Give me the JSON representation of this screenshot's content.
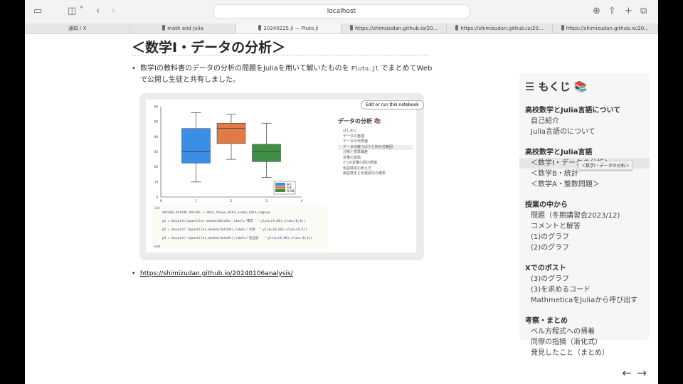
{
  "browser": {
    "url": "localhost",
    "tabs": [
      {
        "label": "通知 / X"
      },
      {
        "label": "math and Julia"
      },
      {
        "label": "20240225.jl — Pluto.jl"
      },
      {
        "label": "https://shimizudan.github.io/20..."
      },
      {
        "label": "https://shimizudan.github.io/20..."
      },
      {
        "label": "https://shimizudan.github.io/20..."
      }
    ]
  },
  "main": {
    "heading": "＜数学I・データの分析＞",
    "para1": "数学Iの教科書のデータの分析の問題をJuliaを用いて解いたものを",
    "para1_code": "Pluto.jl",
    "para1_tail": "でまとめてWebで公開し生徒と共有しました。",
    "link": "https://shimizudan.github.io/20240106analysis/"
  },
  "embed": {
    "edit_button": "Edit or run this notebook",
    "toc_title": "データの分析 📚",
    "toc_items": [
      "はじめに",
      "データの整理",
      "データの代表値",
      "データの散らばりと四分位範囲",
      "分散と標準偏差",
      "変量の変換",
      "2つの変量の間の関係",
      "仮説検定の考え方",
      "仮説検定と反復試行の確率"
    ],
    "code": [
      "let",
      "    data9a,data9b,data9c = data_tokyo,data_osaka,data_nagoya",
      "",
      "    p1 = boxplot(quantiles_monka(data9a),label=\"東京  \",ylim=(0,60),xlim=(0,4))",
      "",
      "    p2 = boxplot!(quantiles_monka(data9b),label=\"大阪  \",ylim=(0,60),xlim=(0,4))",
      "",
      "    p3 = boxplot!(quantiles_monka(data9c),label=\"名古屋   \",ylim=(0,60),xlim=(0,4))",
      "",
      "end"
    ]
  },
  "chart_data": {
    "type": "box",
    "xlim": [
      0,
      4
    ],
    "ylim": [
      0,
      60
    ],
    "xticks": [
      "0",
      "1",
      "2",
      "3",
      "4"
    ],
    "yticks": [
      "0",
      "10",
      "20",
      "30",
      "40",
      "50",
      "60"
    ],
    "series": [
      {
        "name": "東京",
        "x": 1,
        "min": 10,
        "q1": 22.5,
        "median": 30,
        "q3": 45.5,
        "max": 56,
        "color": "#3a8ee6"
      },
      {
        "name": "大阪",
        "x": 2,
        "min": 25,
        "q1": 35.5,
        "median": 45.5,
        "q3": 49,
        "max": 55,
        "color": "#e07b45"
      },
      {
        "name": "名古屋",
        "x": 3,
        "min": 13,
        "q1": 23.5,
        "median": 30,
        "q3": 35,
        "max": 49,
        "color": "#3f8f45"
      }
    ],
    "legend": "bottom-right"
  },
  "toc": {
    "title": "もくじ 📚",
    "sections": [
      {
        "heading": "高校数学とJulia言語について",
        "items": [
          "自己紹介",
          "Julia言語のについて"
        ]
      },
      {
        "heading": "高校数学とJulia言語",
        "items": [
          "＜数学I・データの分析＞",
          "＜数学B・統計",
          "＜数学A・整数問題＞"
        ]
      },
      {
        "heading": "授業の中から",
        "items": [
          "問題（冬期講習会2023/12)",
          "コメントと解答",
          "(1)のグラフ",
          "(2)のグラフ"
        ]
      },
      {
        "heading": "Xでのポスト",
        "items": [
          "(3)のグラフ",
          "(3)を求めるコード",
          "MathmeticaをJuliaから呼び出す"
        ]
      },
      {
        "heading": "考察・まとめ",
        "items": [
          "ベル方程式への帰着",
          "同僚の指摘（漸化式）",
          "発見したこと（まとめ）"
        ]
      }
    ],
    "tooltip": "＜数学I・データの分析＞"
  }
}
